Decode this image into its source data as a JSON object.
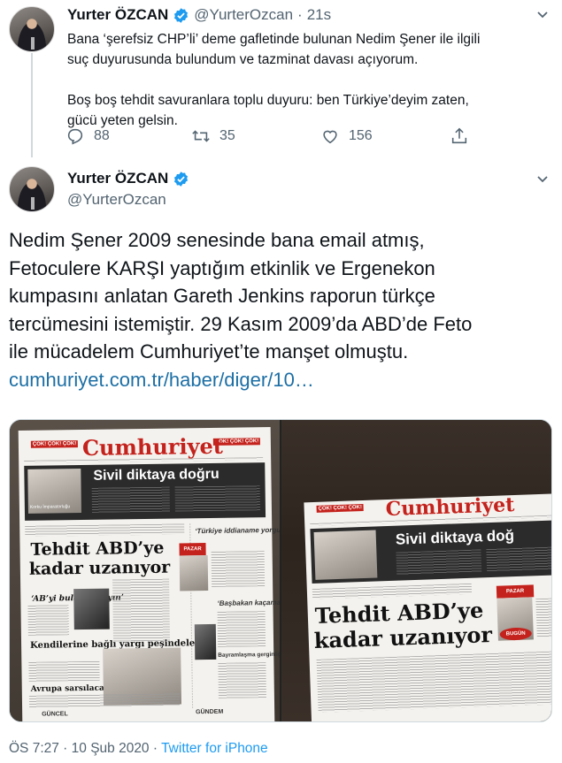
{
  "tweet1": {
    "name": "Yurter ÖZCAN",
    "handle": "@YurterOzcan",
    "separator": "·",
    "time": "21s",
    "lines": [
      "Bana ‘şerefsiz CHP’li’ deme gafletinde bulunan Nedim Şener ile ilgili",
      "suç duyurusunda bulundum ve tazminat davası açıyorum.",
      "",
      "Boş boş tehdit savuranlara toplu duyuru: ben Türkiye’deyim zaten,",
      "gücü yeten gelsin."
    ],
    "replies": "88",
    "retweets": "35",
    "likes": "156"
  },
  "tweet2": {
    "name": "Yurter ÖZCAN",
    "handle": "@YurterOzcan",
    "lines": [
      "Nedim Şener 2009 senesinde bana email atmış,",
      "Fetoculere KARŞI yaptığım etkinlik ve Ergenekon",
      "kumpasını anlatan Gareth Jenkins raporun türkçe",
      "tercümesini istemiştir. 29 Kasım 2009’da ABD’de Feto",
      "ile mücadelem Cumhuriyet’te manşet olmuştu."
    ],
    "link": "cumhuriyet.com.tr/haber/diger/10…",
    "timestamp": "ÖS 7:27 · 10 Şub 2020 · ",
    "source": "Twitter for iPhone"
  },
  "newspaper": {
    "masthead": "Cumhuriyet",
    "stamp": "ÇOK! ÇOK! ÇOK!",
    "banner": "Sivil diktaya doğru",
    "banner_partial": "Sivil diktaya doğ",
    "headline_left": [
      "Tehdit ABD’ye",
      "kadar uzanıyor"
    ],
    "headline_right": [
      "Tehdit ABD’ye",
      "kadar uzanıyor"
    ],
    "sub1": "‘AB’yi bulaştırmayın’",
    "sub2": "Kendilerine bağlı yargı peşindeler",
    "sub3": "Avrupa sarsılacak",
    "side1": "‘Türkiye iddianame yorgunu’",
    "side2": "‘Başbakan kaçamaz’",
    "side3": "Bayramlaşma gerginliği",
    "pazar": "PAZAR",
    "bugun": "BUGÜN",
    "guncel": "GÜNCEL",
    "gundem": "GÜNDEM",
    "korku": "Korku İmparatorluğu"
  },
  "colors": {
    "verified": "#1d9bf0",
    "link": "#1d6fa5",
    "muted": "#536471",
    "masthead_red": "#c4221c"
  },
  "icons": [
    "verified-badge-icon",
    "reply-icon",
    "retweet-icon",
    "like-icon",
    "share-icon",
    "chevron-down-icon"
  ]
}
